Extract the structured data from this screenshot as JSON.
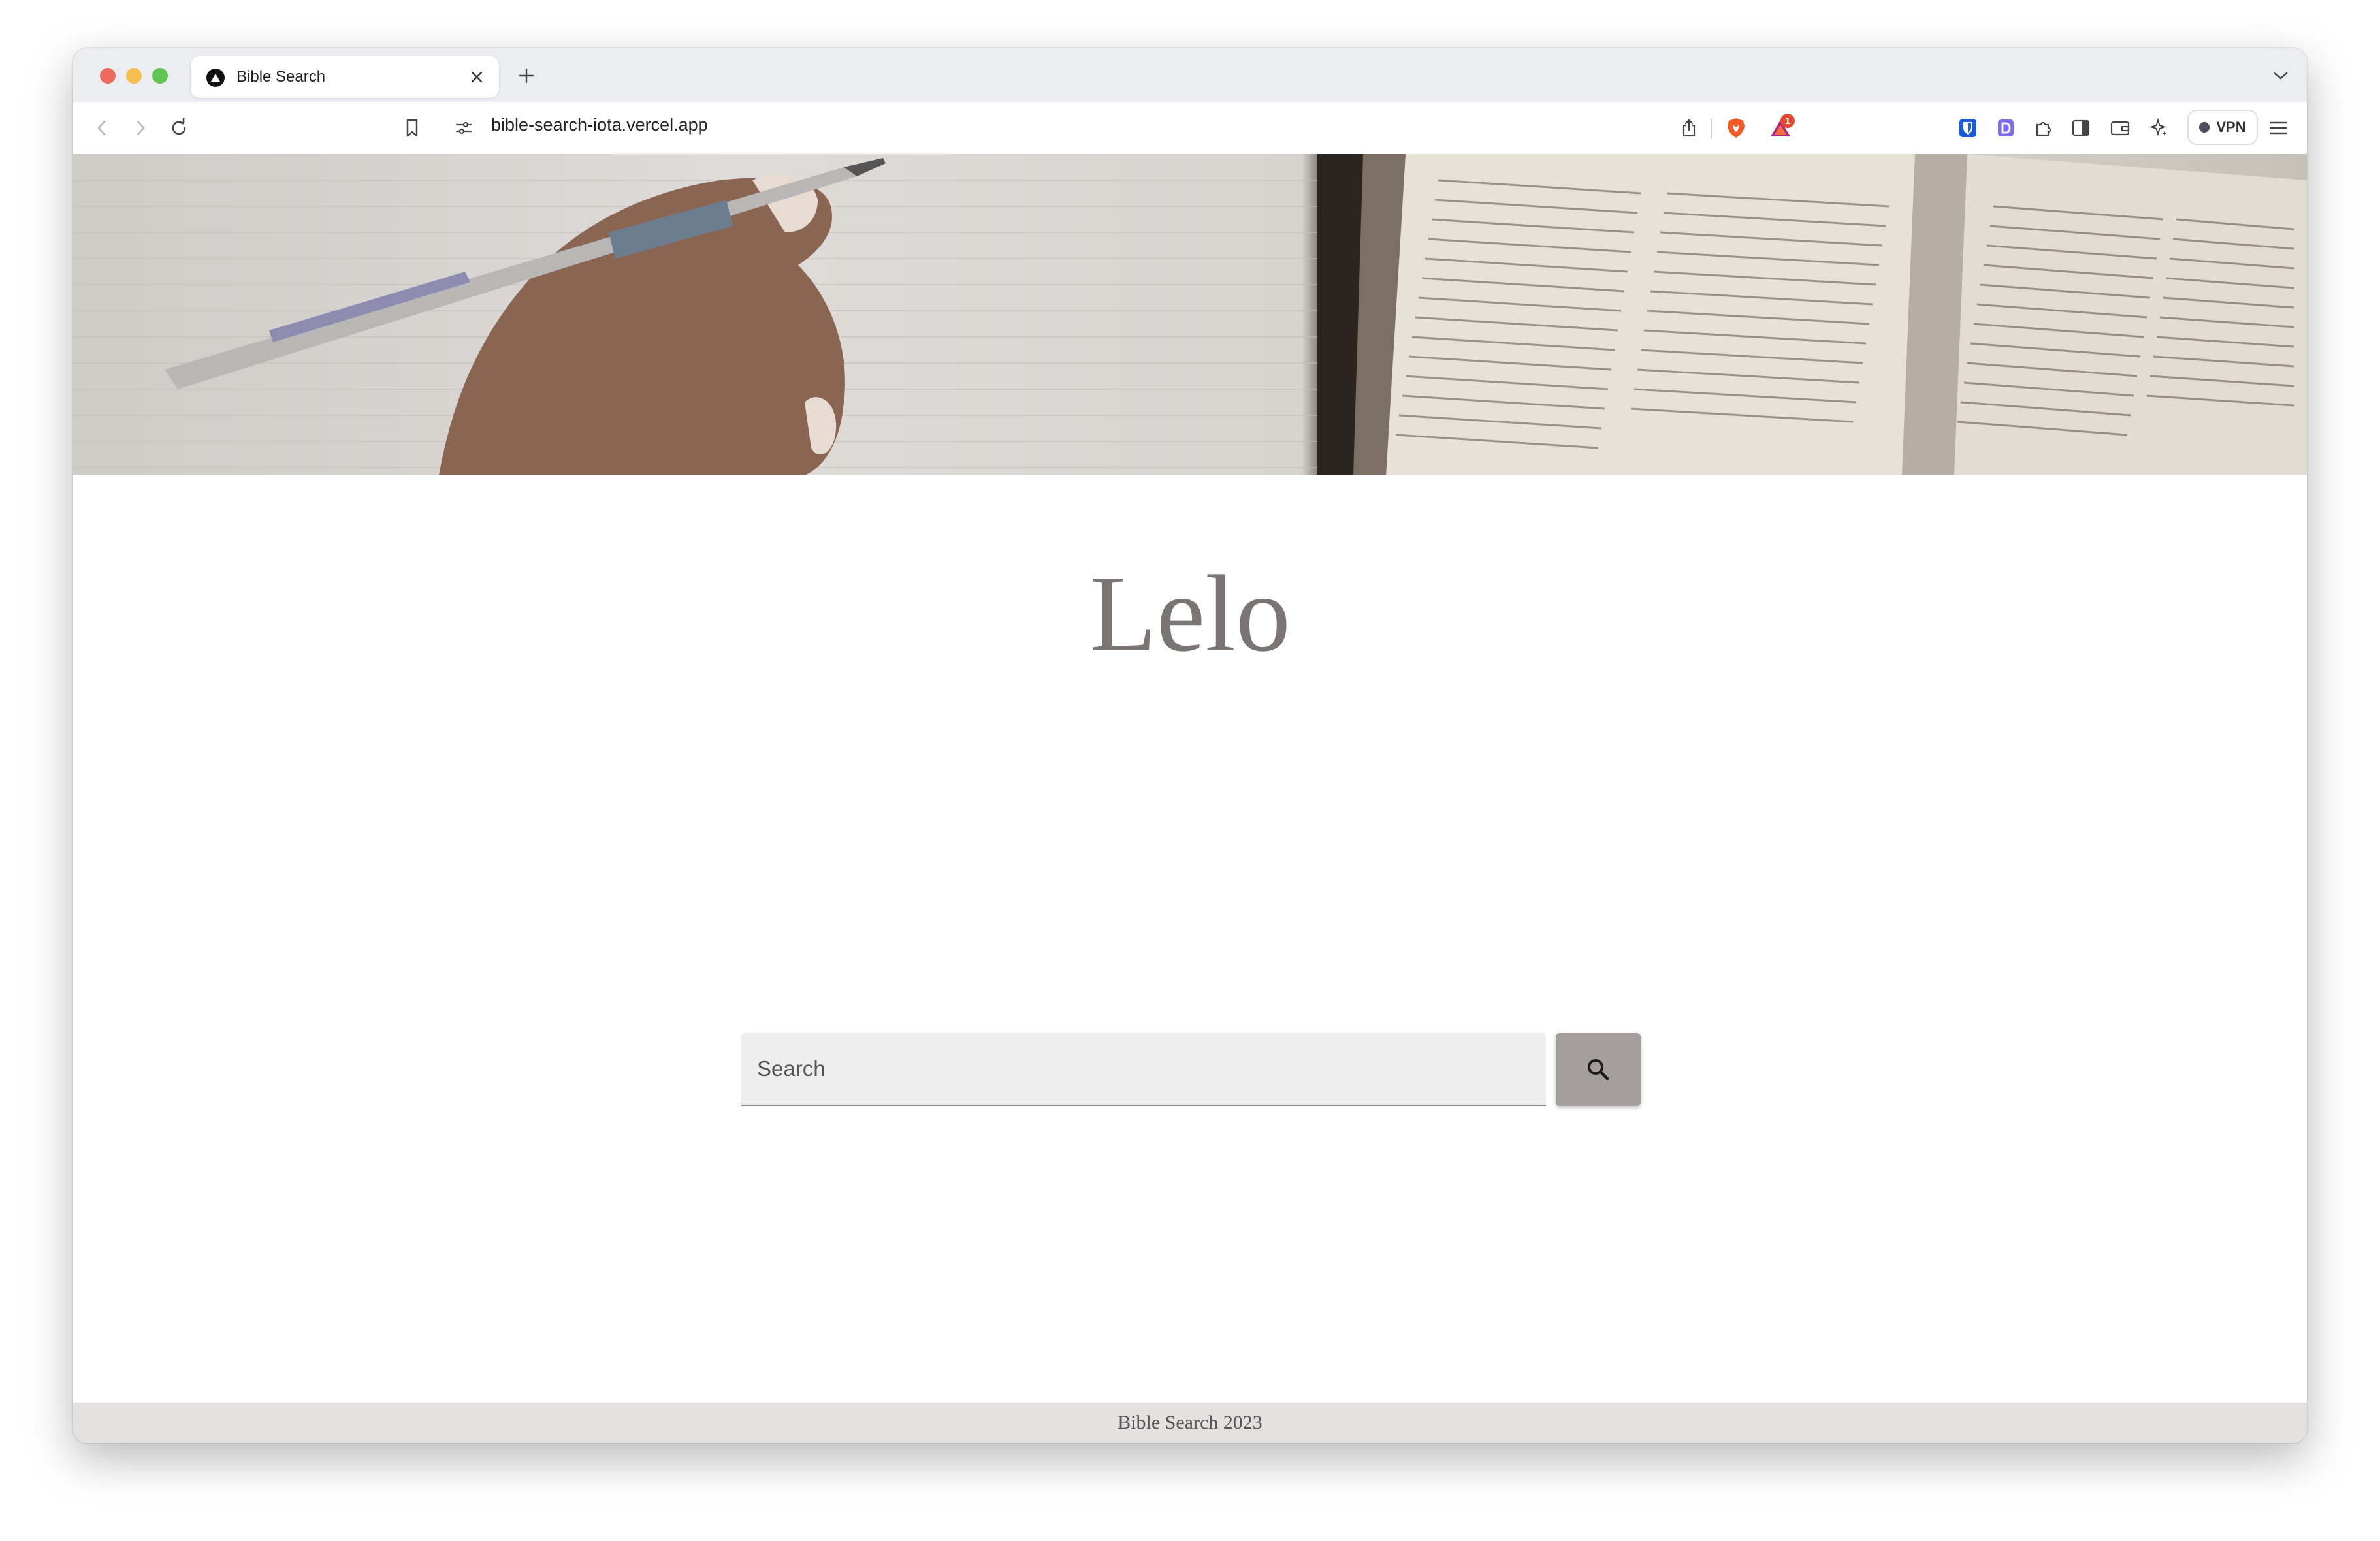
{
  "browser": {
    "tab": {
      "title": "Bible Search",
      "favicon": "vercel-triangle-icon"
    },
    "address_bar": {
      "url": "bible-search-iota.vercel.app"
    },
    "brave_rewards_badge": "1",
    "vpn_label": "VPN",
    "icons": [
      "back-icon",
      "forward-icon",
      "reload-icon",
      "bookmark-icon",
      "site-settings-icon",
      "share-icon",
      "brave-shields-icon",
      "brave-rewards-icon",
      "bitwarden-icon",
      "extension-d-icon",
      "extensions-icon",
      "sidebar-icon",
      "wallet-icon",
      "leo-ai-icon",
      "menu-icon"
    ]
  },
  "page": {
    "brand": "Lelo",
    "search": {
      "placeholder": "Search",
      "value": ""
    },
    "footer": "Bible Search 2023"
  },
  "colors": {
    "brand_text": "#7a7473",
    "search_button": "#a59c9c",
    "footer_bg": "#e4e0df"
  }
}
